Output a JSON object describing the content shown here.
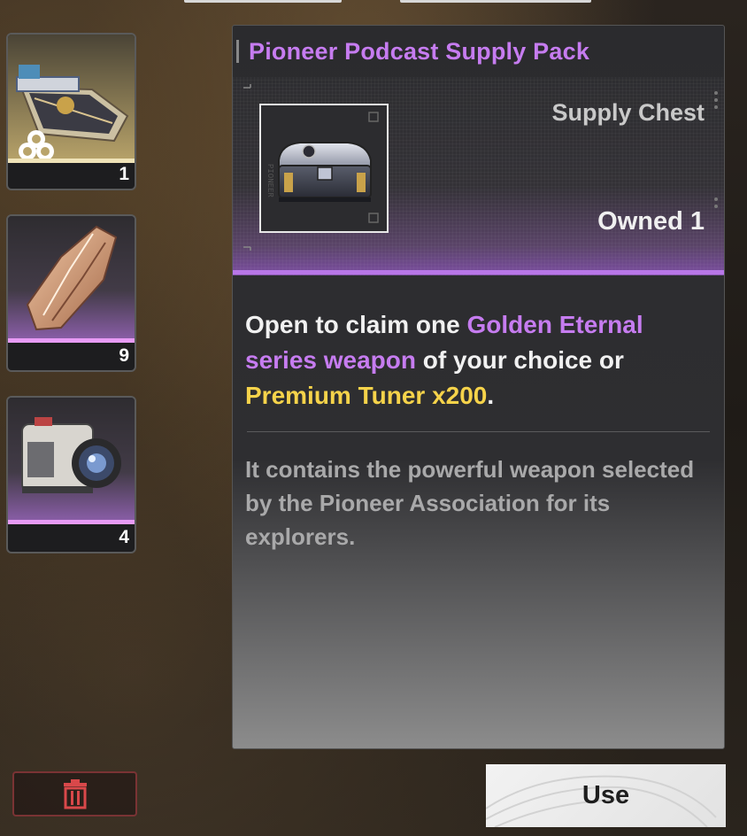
{
  "inventory": {
    "items": [
      {
        "name": "weapon-item",
        "count": "1",
        "rarity_color": "#efe3b8"
      },
      {
        "name": "crystal-item",
        "count": "9",
        "rarity_color": "#e79bf5"
      },
      {
        "name": "camera-item",
        "count": "4",
        "rarity_color": "#e79bf5"
      }
    ]
  },
  "detail": {
    "title": "Pioneer Podcast Supply Pack",
    "type": "Supply Chest",
    "owned": "Owned 1",
    "desc": {
      "part1": "Open to claim one ",
      "highlight1": "Golden Eternal series weapon",
      "part2": " of your choice or ",
      "highlight2": "Premium Tuner x200",
      "part3": "."
    },
    "lore": "It contains the powerful weapon selected by the Pioneer Association for its explorers."
  },
  "actions": {
    "use_label": "Use"
  },
  "colors": {
    "accent_purple": "#c67cf0",
    "accent_gold": "#f6d34a",
    "delete_red": "#d9484a"
  },
  "icons": [
    "trash-icon",
    "supply-chest-icon",
    "weapon-icon",
    "crystal-icon",
    "camera-icon"
  ]
}
